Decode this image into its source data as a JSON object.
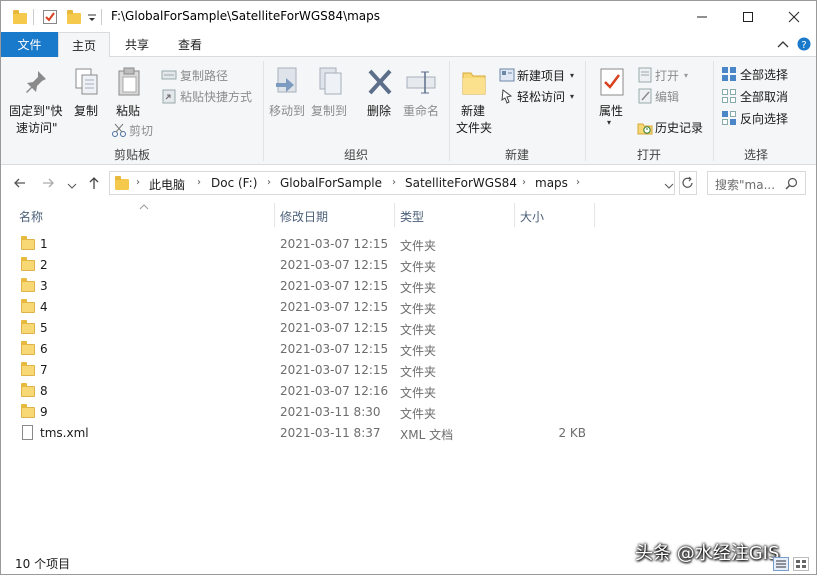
{
  "window": {
    "title": "F:\\GlobalForSample\\SatelliteForWGS84\\maps"
  },
  "tabs": {
    "file": "文件",
    "home": "主页",
    "share": "共享",
    "view": "查看"
  },
  "ribbon": {
    "clipboard": {
      "label": "剪贴板",
      "pin_line1": "固定到\"快",
      "pin_line2": "速访问\"",
      "copy": "复制",
      "paste": "粘贴",
      "copy_path": "复制路径",
      "paste_shortcut": "粘贴快捷方式",
      "cut": "剪切"
    },
    "organize": {
      "label": "组织",
      "move_to": "移动到",
      "copy_to": "复制到",
      "delete": "删除",
      "rename": "重命名"
    },
    "new": {
      "label": "新建",
      "new_folder_line1": "新建",
      "new_folder_line2": "文件夹",
      "new_item": "新建项目",
      "easy_access": "轻松访问"
    },
    "open": {
      "label": "打开",
      "properties": "属性",
      "open": "打开",
      "edit": "编辑",
      "history": "历史记录"
    },
    "select": {
      "label": "选择",
      "select_all": "全部选择",
      "select_none": "全部取消",
      "invert": "反向选择"
    }
  },
  "address": {
    "crumbs": [
      "此电脑",
      "Doc (F:)",
      "GlobalForSample",
      "SatelliteForWGS84",
      "maps"
    ],
    "search_placeholder": "搜索\"ma..."
  },
  "columns": {
    "name": "名称",
    "date": "修改日期",
    "type": "类型",
    "size": "大小"
  },
  "files": [
    {
      "name": "1",
      "date": "2021-03-07 12:15",
      "type": "文件夹",
      "size": "",
      "kind": "folder"
    },
    {
      "name": "2",
      "date": "2021-03-07 12:15",
      "type": "文件夹",
      "size": "",
      "kind": "folder"
    },
    {
      "name": "3",
      "date": "2021-03-07 12:15",
      "type": "文件夹",
      "size": "",
      "kind": "folder"
    },
    {
      "name": "4",
      "date": "2021-03-07 12:15",
      "type": "文件夹",
      "size": "",
      "kind": "folder"
    },
    {
      "name": "5",
      "date": "2021-03-07 12:15",
      "type": "文件夹",
      "size": "",
      "kind": "folder"
    },
    {
      "name": "6",
      "date": "2021-03-07 12:15",
      "type": "文件夹",
      "size": "",
      "kind": "folder"
    },
    {
      "name": "7",
      "date": "2021-03-07 12:15",
      "type": "文件夹",
      "size": "",
      "kind": "folder"
    },
    {
      "name": "8",
      "date": "2021-03-07 12:16",
      "type": "文件夹",
      "size": "",
      "kind": "folder"
    },
    {
      "name": "9",
      "date": "2021-03-11 8:30",
      "type": "文件夹",
      "size": "",
      "kind": "folder"
    },
    {
      "name": "tms.xml",
      "date": "2021-03-11 8:37",
      "type": "XML 文档",
      "size": "2 KB",
      "kind": "file"
    }
  ],
  "status": {
    "count": "10 个项目"
  },
  "watermark": "头条 @水经注GIS",
  "colors": {
    "accent": "#1979ca",
    "folder": "#f8d775"
  }
}
